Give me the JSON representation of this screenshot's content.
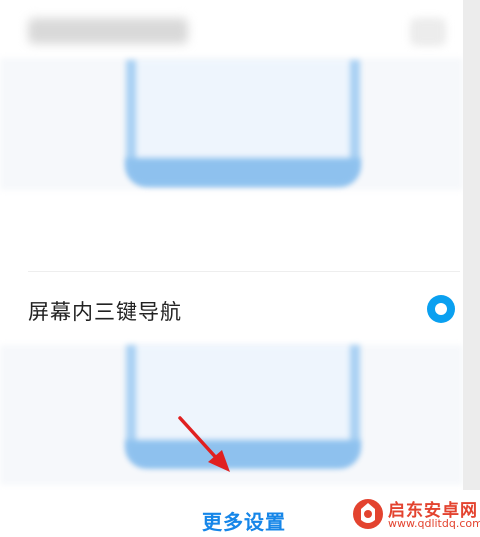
{
  "option": {
    "label": "屏幕内三键导航",
    "selected": true
  },
  "footer": {
    "more_settings_label": "更多设置"
  },
  "watermark": {
    "title": "启东安卓网",
    "url": "www.qdlitdq.com"
  },
  "colors": {
    "accent": "#0aa0f0",
    "link": "#1686e8",
    "arrow": "#e02020",
    "watermark": "#e3432f"
  }
}
